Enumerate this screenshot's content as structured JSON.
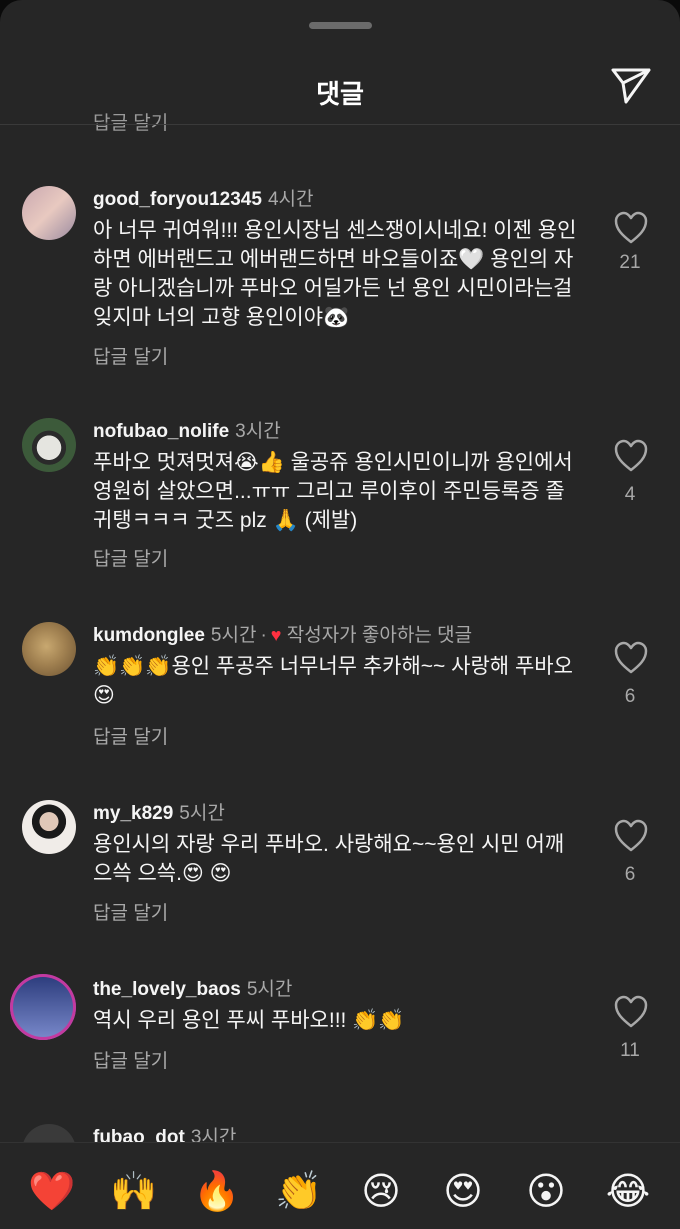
{
  "header": {
    "title": "댓글",
    "partial_reply_label": "답글 달기"
  },
  "comments": [
    {
      "username": "good_foryou12345",
      "time": "4시간",
      "text": "아 너무 귀여워!!! 용인시장님 센스쟁이시네요! 이젠 용인 하면 에버랜드고 에버랜드하면 바오들이죠🤍 용인의 자랑 아니겠습니까 푸바오 어딜가든 넌 용인 시민이라는걸 잊지마 너의 고향 용인이야🐼",
      "reply_label": "답글 달기",
      "likes": "21",
      "avatar_colors": [
        "#c9a8b0",
        "#e8c9c0",
        "#9a8aa0"
      ]
    },
    {
      "username": "nofubao_nolife",
      "time": "3시간",
      "text": "푸바오 멋져멋져😭👍 울공쥬 용인시민이니까 용인에서 영원히 살았으면...ㅠㅠ 그리고 루이후이 주민등록증 졸귀탱ㅋㅋㅋ 굿즈 plz 🙏 (제발)",
      "reply_label": "답글 달기",
      "likes": "4",
      "avatar_colors": [
        "#3c5a3a",
        "#e5e5e0",
        "#2a2a2a"
      ]
    },
    {
      "username": "kumdonglee",
      "time": "5시간",
      "liked_by_author": "작성자가 좋아하는 댓글",
      "text": "👏👏👏용인 푸공주 너무너무 추카해~~ 사랑해 푸바오😍",
      "reply_label": "답글 달기",
      "likes": "6",
      "avatar_colors": [
        "#a08050",
        "#c8a870",
        "#6a5030"
      ]
    },
    {
      "username": "my_k829",
      "time": "5시간",
      "text": "용인시의 자랑 우리 푸바오. 사랑해요~~용인 시민 어깨 으쓱 으쓱.😍 😍",
      "reply_label": "답글 달기",
      "likes": "6",
      "avatar_colors": [
        "#f0ece8",
        "#1a1a1a",
        "#e0c8b8"
      ]
    },
    {
      "username": "the_lovely_baos",
      "time": "5시간",
      "text": "역시 우리 용인 푸씨 푸바오!!! 👏👏",
      "reply_label": "답글 달기",
      "likes": "11",
      "avatar_colors": [
        "#2a3a7a",
        "#7a8acc",
        "#c33aa0"
      ]
    },
    {
      "username": "fubao_dot",
      "time": "3시간"
    }
  ],
  "reactions": [
    {
      "icon": "red-heart",
      "glyph": "❤️"
    },
    {
      "icon": "raising-hands",
      "glyph": "🙌"
    },
    {
      "icon": "fire",
      "glyph": "🔥"
    },
    {
      "icon": "clapping-hands",
      "glyph": "👏"
    },
    {
      "icon": "crying-face",
      "glyph": "😢"
    },
    {
      "icon": "heart-eyes",
      "glyph": "😍"
    },
    {
      "icon": "surprised-face",
      "glyph": "😮"
    },
    {
      "icon": "tears-of-joy",
      "glyph": "😂"
    }
  ],
  "colors": {
    "sheet": "#262626",
    "muted": "#a8a8a8",
    "accent_heart": "#ff3040"
  }
}
